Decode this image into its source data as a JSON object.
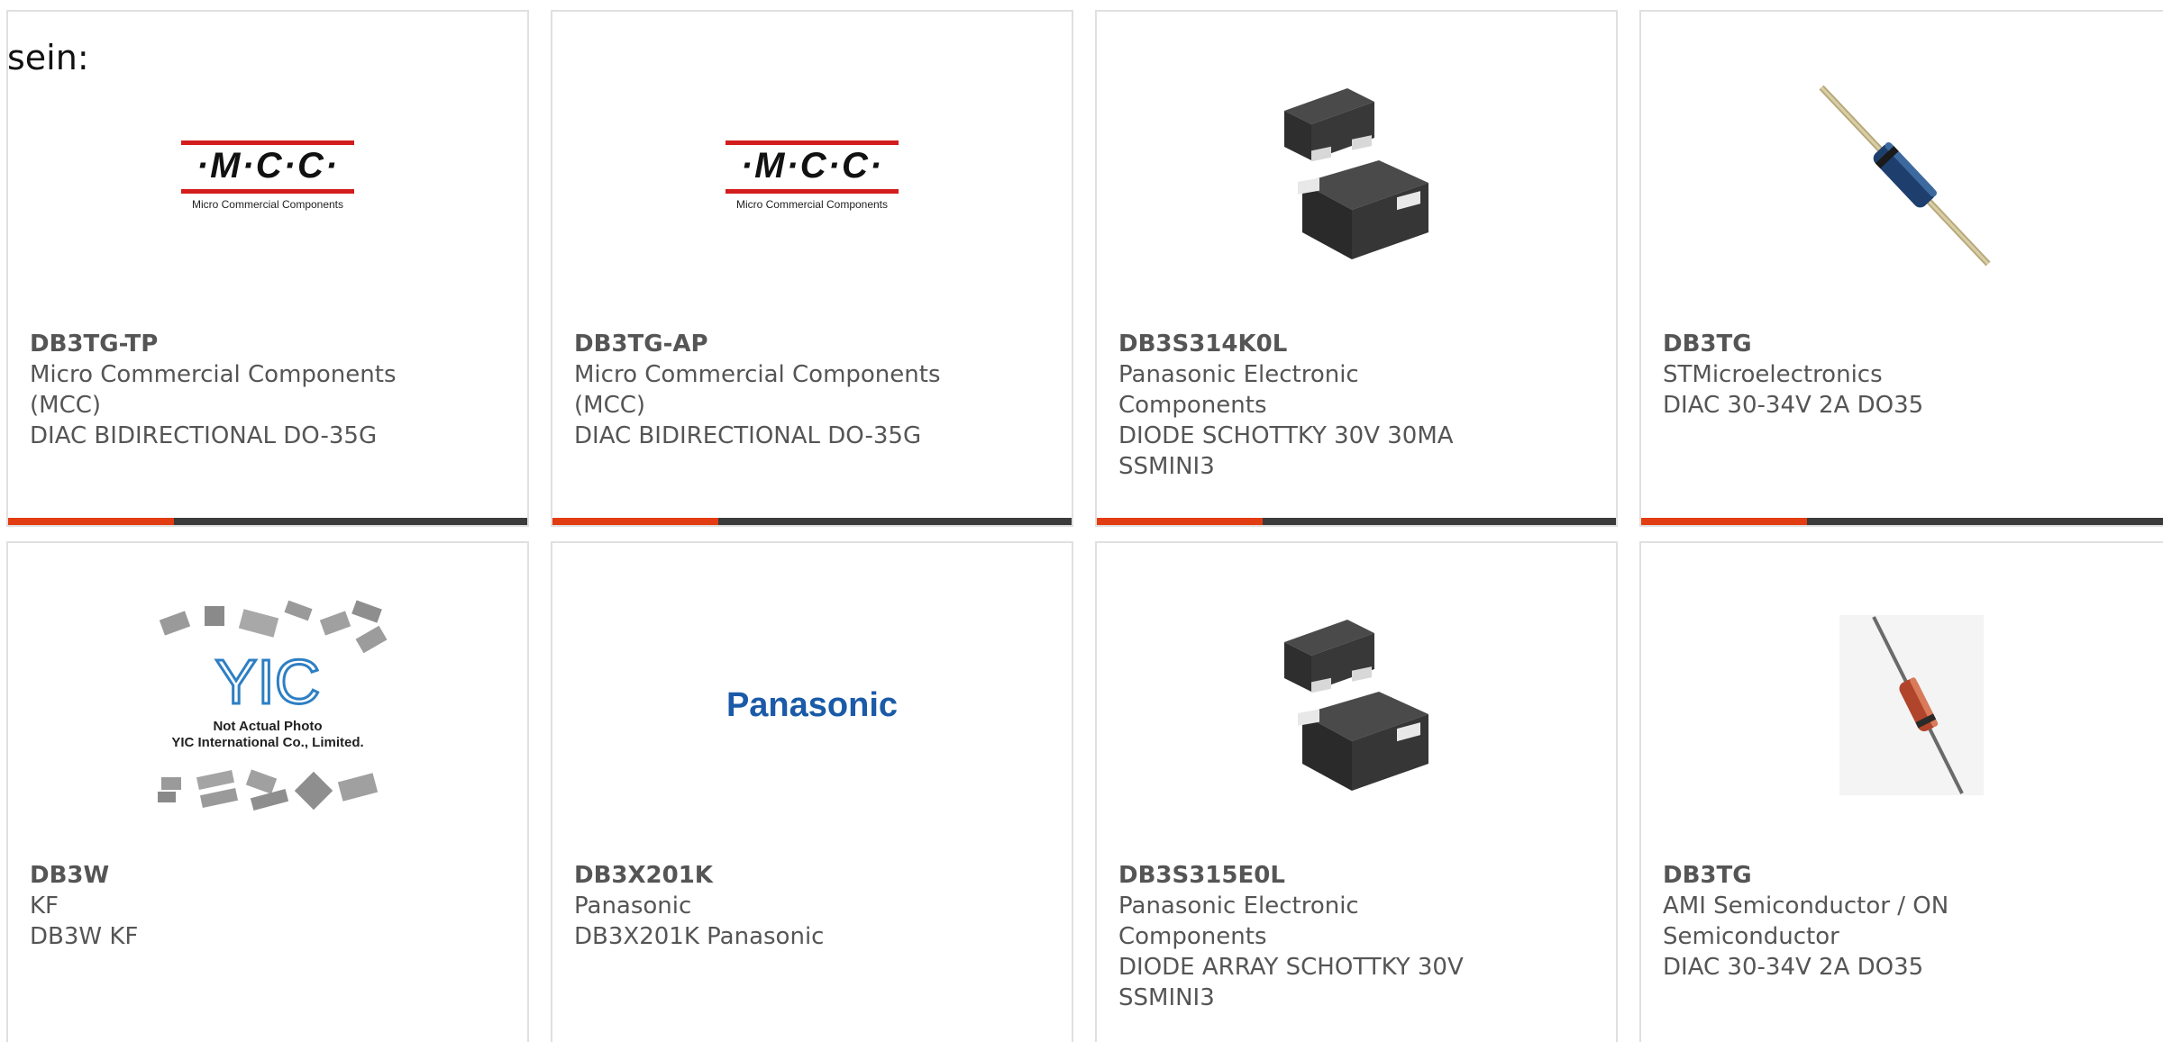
{
  "intro_text": "sein:",
  "colors": {
    "accent": "#e23d12",
    "bar_dark": "#3b3b3b",
    "text_gray": "#555555",
    "card_border": "#e0e0e0",
    "mcc_red": "#d31c1c",
    "panasonic_blue": "#1a5aa8"
  },
  "logos": {
    "mcc_text": "·M·C·C·",
    "mcc_sub": "Micro Commercial Components",
    "panasonic": "Panasonic",
    "yic_brand": "YIC",
    "yic_line1": "Not Actual Photo",
    "yic_line2": "YIC International Co., Limited."
  },
  "products": [
    {
      "part": "DB3TG-TP",
      "manufacturer": "Micro Commercial Components (MCC)",
      "description": "DIAC BIDIRECTIONAL DO-35G",
      "image": "mcc-logo"
    },
    {
      "part": "DB3TG-AP",
      "manufacturer": "Micro Commercial Components (MCC)",
      "description": "DIAC BIDIRECTIONAL DO-35G",
      "image": "mcc-logo"
    },
    {
      "part": "DB3S314K0L",
      "manufacturer": "Panasonic Electronic Components",
      "description": "DIODE SCHOTTKY 30V 30MA SSMINI3",
      "image": "smd-package-icon"
    },
    {
      "part": "DB3TG",
      "manufacturer": "STMicroelectronics",
      "description": "DIAC 30-34V 2A DO35",
      "image": "diode-blue-icon"
    },
    {
      "part": "DB3W",
      "manufacturer": "KF",
      "description": "DB3W KF",
      "image": "yic-placeholder"
    },
    {
      "part": "DB3X201K",
      "manufacturer": "Panasonic",
      "description": "DB3X201K Panasonic",
      "image": "panasonic-logo"
    },
    {
      "part": "DB3S315E0L",
      "manufacturer": "Panasonic Electronic Components",
      "description": "DIODE ARRAY SCHOTTKY 30V SSMINI3",
      "image": "smd-package-icon"
    },
    {
      "part": "DB3TG",
      "manufacturer": "AMI Semiconductor / ON Semiconductor",
      "description": "DIAC 30-34V 2A DO35",
      "image": "diode-red-icon"
    }
  ]
}
